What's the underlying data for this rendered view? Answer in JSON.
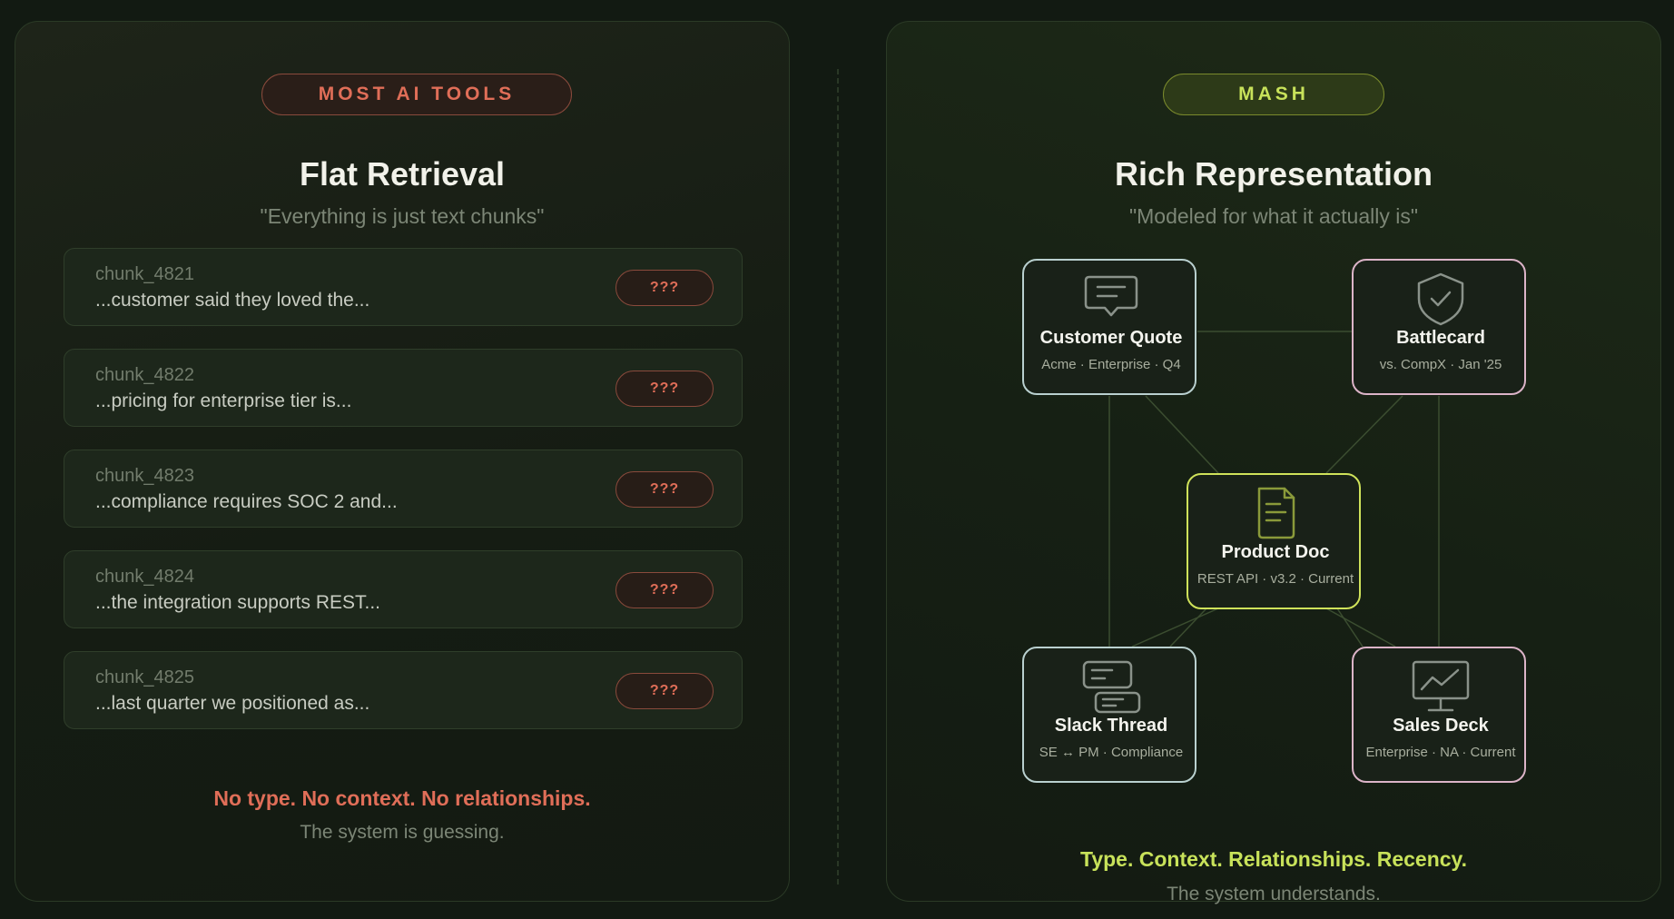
{
  "left": {
    "badge": "MOST AI TOOLS",
    "title": "Flat Retrieval",
    "subtitle": "\"Everything is just text chunks\"",
    "chunks": [
      {
        "id": "chunk_4821",
        "text": "...customer said they loved the...",
        "tag": "???"
      },
      {
        "id": "chunk_4822",
        "text": "...pricing for enterprise tier is...",
        "tag": "???"
      },
      {
        "id": "chunk_4823",
        "text": "...compliance requires SOC 2 and...",
        "tag": "???"
      },
      {
        "id": "chunk_4824",
        "text": "...the integration supports REST...",
        "tag": "???"
      },
      {
        "id": "chunk_4825",
        "text": "...last quarter we positioned as...",
        "tag": "???"
      }
    ],
    "summary": "No type. No context. No relationships.",
    "summary_sub": "The system is guessing."
  },
  "right": {
    "badge": "MASH",
    "title": "Rich Representation",
    "subtitle": "\"Modeled for what it actually is\"",
    "nodes": [
      {
        "label": "Customer Quote",
        "meta": "Acme · Enterprise · Q4",
        "icon": "speech-bubble-icon"
      },
      {
        "label": "Battlecard",
        "meta": "vs. CompX · Jan '25",
        "icon": "shield-check-icon"
      },
      {
        "label": "Product Doc",
        "meta": "REST API · v3.2 · Current",
        "icon": "document-icon"
      },
      {
        "label": "Slack Thread",
        "meta": "SE ↔ PM · Compliance",
        "icon": "chat-thread-icon"
      },
      {
        "label": "Sales Deck",
        "meta": "Enterprise · NA · Current",
        "icon": "presentation-chart-icon"
      }
    ],
    "summary": "Type. Context. Relationships. Recency.",
    "summary_sub": "The system understands."
  },
  "colors": {
    "background": "#121a12",
    "warning_accent": "#e06e58",
    "mash_accent": "#c8e25a",
    "node_border_blue": "#b9d0cf",
    "node_border_pink": "#dcb4c8",
    "connector": "#3b4d30"
  }
}
